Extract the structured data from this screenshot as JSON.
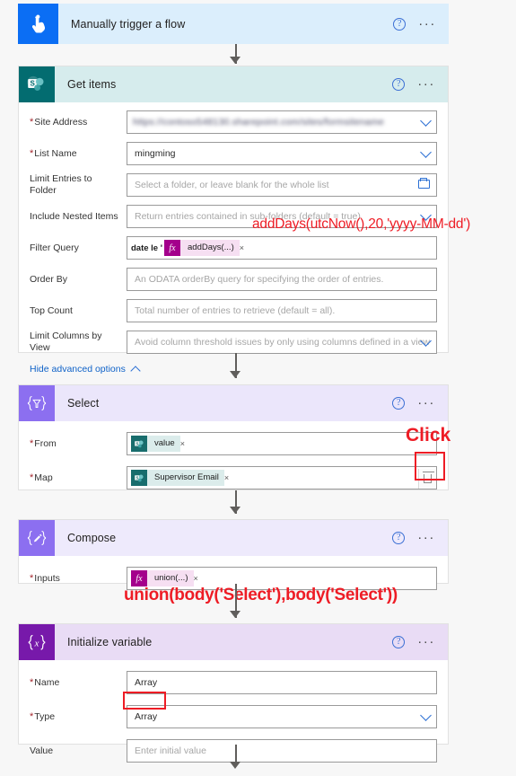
{
  "flow": {
    "steps": [
      {
        "id": "trigger",
        "title": "Manually trigger a flow",
        "icon": "tap-hand-icon",
        "icon_bg": "#0b6ef4",
        "header_bg": "#dbeefc",
        "help_label": "?",
        "more_label": "···"
      },
      {
        "id": "get-items",
        "title": "Get items",
        "icon": "sharepoint-icon",
        "icon_bg": "#036c70",
        "header_bg": "#d6eced",
        "help_label": "?",
        "more_label": "···",
        "fields": [
          {
            "label": "Site Address",
            "required": true,
            "value": "https://contoso548130.sharepoint.com/sites/formsitename",
            "redacted": true,
            "control": "dropdown"
          },
          {
            "label": "List Name",
            "required": true,
            "value": "mingming",
            "control": "dropdown"
          },
          {
            "label": "Limit Entries to Folder",
            "required": false,
            "placeholder": "Select a folder, or leave blank for the whole list",
            "control": "folder-picker"
          },
          {
            "label": "Include Nested Items",
            "required": false,
            "placeholder": "Return entries contained in sub-folders (default = true)",
            "control": "dropdown"
          },
          {
            "label": "Filter Query",
            "required": false,
            "control": "token-field",
            "prefix": "date le '",
            "token": {
              "type": "fx",
              "text": "addDays(...)"
            }
          },
          {
            "label": "Order By",
            "required": false,
            "placeholder": "An ODATA orderBy query for specifying the order of entries.",
            "control": "text"
          },
          {
            "label": "Top Count",
            "required": false,
            "placeholder": "Total number of entries to retrieve (default = all).",
            "control": "text"
          },
          {
            "label": "Limit Columns by View",
            "required": false,
            "placeholder": "Avoid column threshold issues by only using columns defined in a view",
            "control": "dropdown"
          }
        ],
        "advanced_link": "Hide advanced options"
      },
      {
        "id": "select",
        "title": "Select",
        "icon": "select-braces-icon",
        "icon_bg": "#8c6ff0",
        "header_bg": "#ebe6fb",
        "help_label": "?",
        "more_label": "···",
        "fields": [
          {
            "label": "From",
            "required": true,
            "control": "token-field",
            "token": {
              "type": "sharepoint",
              "text": "value"
            }
          },
          {
            "label": "Map",
            "required": true,
            "control": "token-field",
            "token": {
              "type": "sharepoint",
              "text": "Supervisor Email"
            },
            "has_delete": true
          }
        ]
      },
      {
        "id": "compose",
        "title": "Compose",
        "icon": "compose-pencil-icon",
        "icon_bg": "#8c6ff0",
        "header_bg": "#eeeafc",
        "help_label": "?",
        "more_label": "···",
        "fields": [
          {
            "label": "Inputs",
            "required": true,
            "control": "token-field",
            "token": {
              "type": "fx",
              "text": "union(...)"
            }
          }
        ]
      },
      {
        "id": "initialize-variable",
        "title": "Initialize variable",
        "icon": "variable-braces-icon",
        "icon_bg": "#7719aa",
        "header_bg": "#e9dcf5",
        "help_label": "?",
        "more_label": "···",
        "fields": [
          {
            "label": "Name",
            "required": true,
            "value": "Array",
            "control": "text"
          },
          {
            "label": "Type",
            "required": true,
            "value": "Array",
            "control": "dropdown",
            "highlighted": true
          },
          {
            "label": "Value",
            "required": false,
            "placeholder": "Enter initial value",
            "control": "text"
          }
        ]
      }
    ]
  },
  "annotations": {
    "filter_formula": "addDays(utcNow(),20,'yyyy-MM-dd')",
    "click_label": "Click",
    "union_formula": "union(body('Select'),body('Select'))"
  },
  "colors": {
    "annotation_red": "#ee1c25",
    "link_blue": "#0f62c8",
    "required_red": "#a4262c",
    "sharepoint_teal": "#036c70",
    "fx_magenta": "#a4008c"
  },
  "token_remove_label": "×"
}
